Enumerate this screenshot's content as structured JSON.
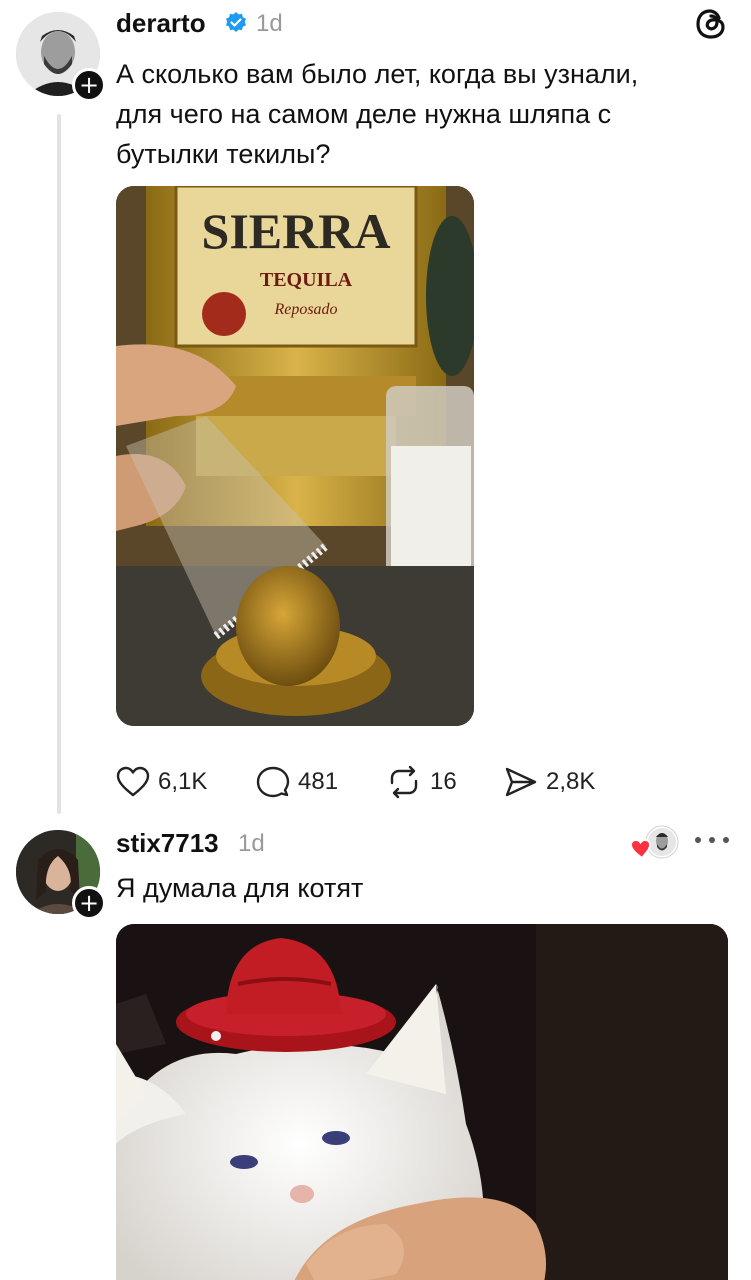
{
  "post1": {
    "username": "derarto",
    "time": "1d",
    "verified": true,
    "text_line1": "А сколько вам было лет, когда вы узнали,",
    "text_line2": "для чего на самом деле нужна шляпа с",
    "text_line3": "бутылки текилы?",
    "image_labels": {
      "brand": "SIERRA",
      "product": "TEQUILA",
      "variant": "Reposado"
    },
    "actions": {
      "likes": "6,1K",
      "replies": "481",
      "reposts": "16",
      "shares": "2,8K"
    },
    "icons": [
      "avatar",
      "plus-icon",
      "verified-icon",
      "threads-logo-icon",
      "heart-icon",
      "comment-icon",
      "repost-icon",
      "share-icon"
    ]
  },
  "post2": {
    "username": "stix7713",
    "time": "1d",
    "text": "Я думала для котят",
    "icons": [
      "avatar",
      "plus-icon",
      "liked-by-author-icon",
      "more-icon"
    ]
  },
  "colors": {
    "text": "#111111",
    "muted": "#9a9a9a",
    "verified": "#1d9bf0",
    "heart": "#ff3040",
    "thread_line": "#e2e2e2"
  }
}
